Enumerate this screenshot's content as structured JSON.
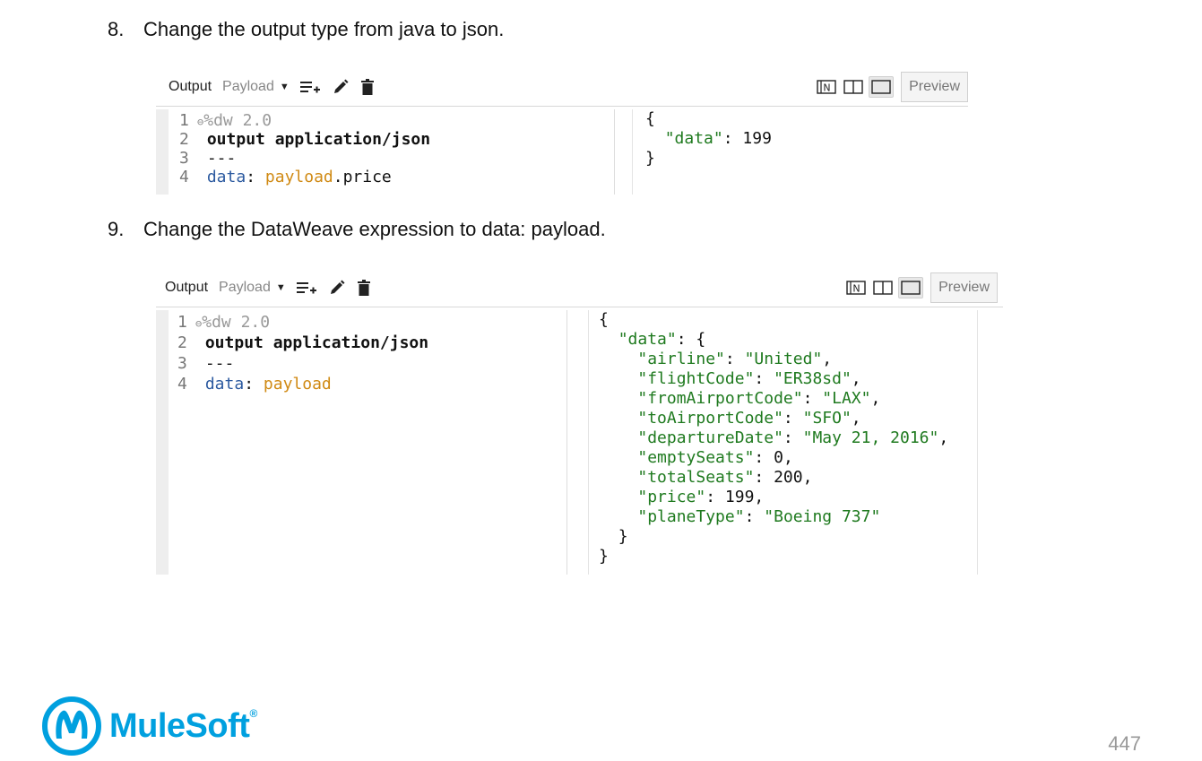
{
  "steps": [
    {
      "number": "8.",
      "text": "Change the output type from java to json."
    },
    {
      "number": "9.",
      "text": "Change the DataWeave expression to data: payload."
    }
  ],
  "toolbar": {
    "output_label": "Output",
    "payload_label": "Payload",
    "caret": "▼",
    "preview_label": "Preview",
    "icons": [
      "add-list-icon",
      "pencil-icon",
      "trash-icon",
      "notebook-view-icon",
      "split-view-icon",
      "single-view-icon"
    ]
  },
  "panel1": {
    "script": {
      "line1_dir": "%dw 2.0",
      "line2": "output application/json",
      "line3": "---",
      "line4_key": "data",
      "line4_payload": "payload",
      "line4_field": ".price"
    },
    "output": {
      "open": "{",
      "key": "\"data\"",
      "value": "199",
      "close": "}"
    }
  },
  "panel2": {
    "script": {
      "line1_dir": "%dw 2.0",
      "line2": "output application/json",
      "line3": "---",
      "line4_key": "data",
      "line4_payload": "payload"
    },
    "output": {
      "open": "{",
      "data_key": "\"data\"",
      "inner_open": "{",
      "fields": [
        {
          "key": "\"airline\"",
          "value": "\"United\"",
          "type": "string"
        },
        {
          "key": "\"flightCode\"",
          "value": "\"ER38sd\"",
          "type": "string"
        },
        {
          "key": "\"fromAirportCode\"",
          "value": "\"LAX\"",
          "type": "string"
        },
        {
          "key": "\"toAirportCode\"",
          "value": "\"SFO\"",
          "type": "string"
        },
        {
          "key": "\"departureDate\"",
          "value": "\"May 21, 2016\"",
          "type": "string"
        },
        {
          "key": "\"emptySeats\"",
          "value": "0",
          "type": "number"
        },
        {
          "key": "\"totalSeats\"",
          "value": "200",
          "type": "number"
        },
        {
          "key": "\"price\"",
          "value": "199",
          "type": "number"
        },
        {
          "key": "\"planeType\"",
          "value": "\"Boeing 737\"",
          "type": "string",
          "last": true
        }
      ],
      "inner_close": "}",
      "close": "}"
    }
  },
  "footer": {
    "brand": "MuleSoft",
    "page_number": "447",
    "brand_color": "#00a0df"
  },
  "colors": {
    "keyword_blue": "#2c5aa0",
    "payload_orange": "#d08a14",
    "json_green": "#1f7a1f"
  }
}
